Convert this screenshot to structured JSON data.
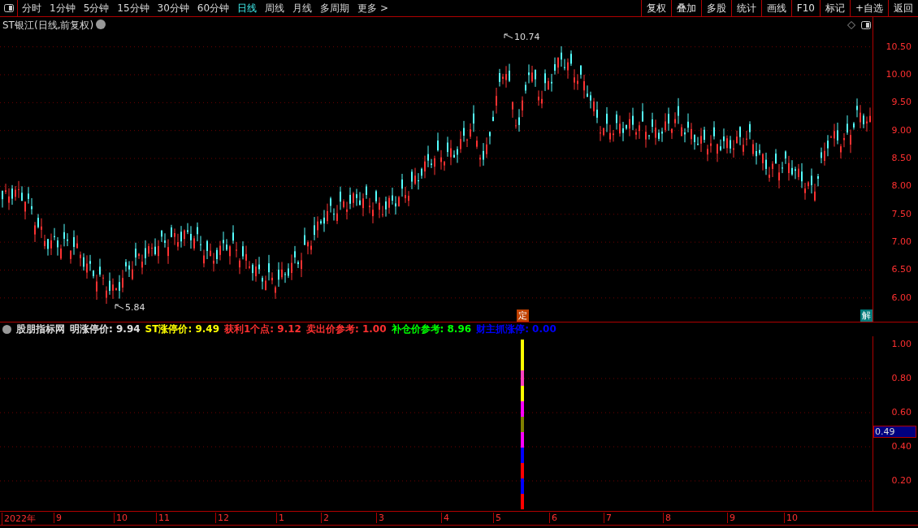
{
  "toolbar": {
    "periods": [
      {
        "label": "分时",
        "selected": false
      },
      {
        "label": "1分钟",
        "selected": false
      },
      {
        "label": "5分钟",
        "selected": false
      },
      {
        "label": "15分钟",
        "selected": false
      },
      {
        "label": "30分钟",
        "selected": false
      },
      {
        "label": "60分钟",
        "selected": false
      },
      {
        "label": "日线",
        "selected": true
      },
      {
        "label": "周线",
        "selected": false
      },
      {
        "label": "月线",
        "selected": false
      },
      {
        "label": "多周期",
        "selected": false
      }
    ],
    "more": "更多 >",
    "buttons": [
      "复权",
      "叠加",
      "多股",
      "统计",
      "画线",
      "F10",
      "标记",
      "+自选",
      "返回"
    ]
  },
  "price_chart": {
    "title": "ST银江(日线,前复权)",
    "high_label": "10.74",
    "low_label": "5.84",
    "markers": [
      {
        "text": "定",
        "kind": "event"
      },
      {
        "text": "解",
        "kind": "info"
      }
    ],
    "y_axis": [
      "10.50",
      "10.00",
      "9.50",
      "9.00",
      "8.50",
      "8.00",
      "7.50",
      "7.00",
      "6.50",
      "6.00"
    ]
  },
  "indicator": {
    "name": "股朋指标网",
    "readings": [
      {
        "text": "明涨停价: 9.94",
        "color": "#e0e0e0"
      },
      {
        "text": "ST涨停价: 9.49",
        "color": "#ffff00"
      },
      {
        "text": "获利1个点: 9.12",
        "color": "#ff3030"
      },
      {
        "text": "卖出价参考: 1.00",
        "color": "#ff3030"
      },
      {
        "text": "补仓价参考: 8.96",
        "color": "#00ff00"
      },
      {
        "text": "财主抓涨停: 0.00",
        "color": "#0000ff"
      }
    ],
    "y_axis": [
      "1.00",
      "0.80",
      "0.60",
      "0.40",
      "0.20"
    ],
    "current": "0.49"
  },
  "time_axis": [
    "2022年",
    "9",
    "10",
    "11",
    "12",
    "1",
    "2",
    "3",
    "4",
    "5",
    "6",
    "7",
    "8",
    "9",
    "10"
  ]
}
